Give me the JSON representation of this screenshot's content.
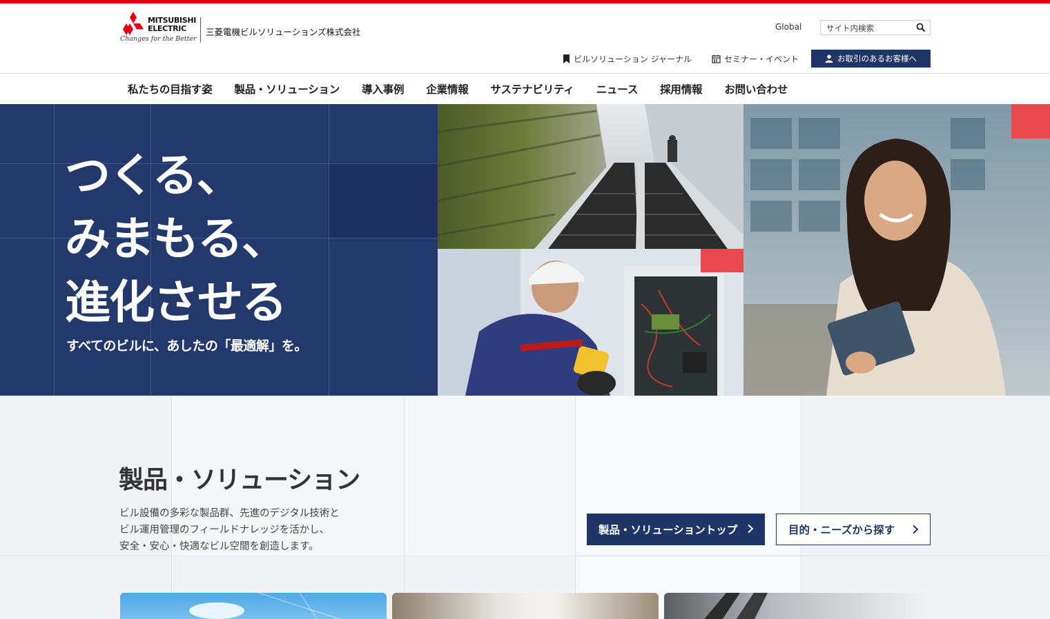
{
  "header": {
    "brand_line1": "MITSUBISHI",
    "brand_line2": "ELECTRIC",
    "tagline": "Changes for the Better",
    "company_name": "三菱電機ビルソリューションズ株式会社",
    "global_label": "Global",
    "search": {
      "placeholder": "サイト内検索"
    },
    "journal_label": "ビルソリューション ジャーナル",
    "seminar_label": "セミナー・イベント",
    "customer_button": "お取引のあるお客様へ"
  },
  "nav": {
    "items": [
      {
        "label": "私たちの目指す姿"
      },
      {
        "label": "製品・ソリューション"
      },
      {
        "label": "導入事例"
      },
      {
        "label": "企業情報"
      },
      {
        "label": "サステナビリティ"
      },
      {
        "label": "ニュース"
      },
      {
        "label": "採用情報"
      },
      {
        "label": "お問い合わせ"
      }
    ]
  },
  "hero": {
    "title_line1": "つくる、",
    "title_line2": "みまもる、",
    "title_line3": "進化させる",
    "subtitle": "すべてのビルに、あしたの「最適解」を。"
  },
  "products": {
    "title": "製品・ソリューション",
    "desc_line1": "ビル設備の多彩な製品群、先進のデジタル技術と",
    "desc_line2": "ビル運用管理のフィールドナレッジを活かし、",
    "desc_line3": "安全・安心・快適なビル空間を創造します。",
    "primary_button": "製品・ソリューショントップ",
    "secondary_button": "目的・ニーズから探す"
  },
  "colors": {
    "accent_red": "#e60012",
    "navy": "#1e3566",
    "hero_navy": "#23386b"
  }
}
